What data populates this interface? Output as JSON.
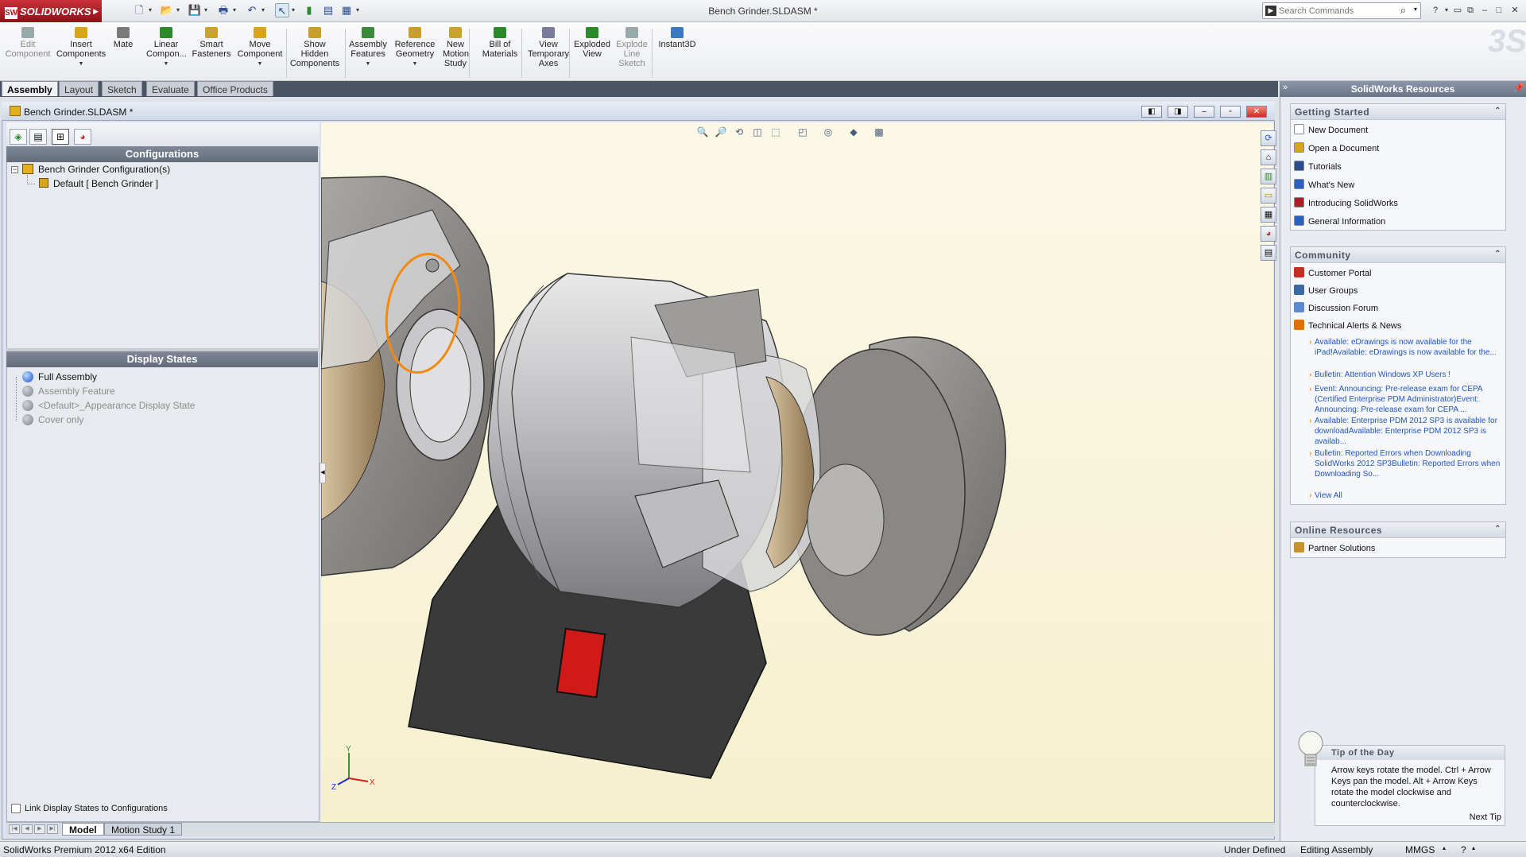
{
  "app": {
    "brand": "SOLIDWORKS",
    "window_title": "Bench Grinder.SLDASM *"
  },
  "search": {
    "placeholder": "Search Commands"
  },
  "command_manager": {
    "tools": [
      {
        "label": "Edit\nComponent",
        "icon": "edit-component-icon",
        "enabled": false
      },
      {
        "label": "Insert\nComponents",
        "icon": "insert-components-icon",
        "enabled": true
      },
      {
        "label": "Mate",
        "icon": "mate-icon",
        "enabled": true
      },
      {
        "label": "Linear\nCompon...",
        "icon": "linear-pattern-icon",
        "enabled": true
      },
      {
        "label": "Smart\nFasteners",
        "icon": "smart-fasteners-icon",
        "enabled": true
      },
      {
        "label": "Move\nComponent",
        "icon": "move-component-icon",
        "enabled": true
      },
      {
        "label": "Show\nHidden\nComponents",
        "icon": "show-hidden-icon",
        "enabled": true
      },
      {
        "label": "Assembly\nFeatures",
        "icon": "assembly-features-icon",
        "enabled": true
      },
      {
        "label": "Reference\nGeometry",
        "icon": "reference-geometry-icon",
        "enabled": true
      },
      {
        "label": "New\nMotion\nStudy",
        "icon": "motion-study-icon",
        "enabled": true
      },
      {
        "label": "Bill of\nMaterials",
        "icon": "bom-icon",
        "enabled": true
      },
      {
        "label": "View\nTemporary\nAxes",
        "icon": "temporary-axes-icon",
        "enabled": true
      },
      {
        "label": "Exploded\nView",
        "icon": "exploded-view-icon",
        "enabled": true
      },
      {
        "label": "Explode\nLine\nSketch",
        "icon": "explode-line-icon",
        "enabled": false
      },
      {
        "label": "Instant3D",
        "icon": "instant3d-icon",
        "enabled": true
      }
    ]
  },
  "tabs": [
    "Assembly",
    "Layout",
    "Sketch",
    "Evaluate",
    "Office Products"
  ],
  "document": {
    "title": "Bench Grinder.SLDASM *"
  },
  "configurations": {
    "header": "Configurations",
    "root": "Bench Grinder Configuration(s)",
    "child": "Default [ Bench Grinder ]"
  },
  "display_states": {
    "header": "Display States",
    "items": [
      {
        "label": "Full Assembly",
        "active": true
      },
      {
        "label": "Assembly Feature",
        "active": false
      },
      {
        "label": "<Default>_Appearance Display State",
        "active": false
      },
      {
        "label": "Cover only",
        "active": false
      }
    ]
  },
  "link_display_states": "Link Display States to Configurations",
  "bottom_tabs": [
    "Model",
    "Motion Study 1"
  ],
  "triad": {
    "x": "X",
    "y": "Y",
    "z": "Z"
  },
  "task_pane": {
    "title": "SolidWorks Resources",
    "getting_started": {
      "header": "Getting Started",
      "items": [
        "New Document",
        "Open a Document",
        "Tutorials",
        "What's New",
        "Introducing SolidWorks",
        "General Information"
      ]
    },
    "community": {
      "header": "Community",
      "items": [
        "Customer Portal",
        "User Groups",
        "Discussion Forum",
        "Technical Alerts & News"
      ],
      "news": [
        "Available: eDrawings is now available for the iPad!Available: eDrawings is now available for the...",
        "Bulletin: Attention Windows XP Users !",
        "Event: Announcing: Pre-release exam for CEPA (Certified Enterprise PDM Administrator)Event: Announcing: Pre-release exam for CEPA ...",
        "Available: Enterprise PDM 2012 SP3 is available for downloadAvailable: Enterprise PDM 2012 SP3 is availab...",
        "Bulletin: Reported Errors when Downloading SolidWorks 2012 SP3Bulletin: Reported Errors when Downloading So..."
      ],
      "view_all": "View All"
    },
    "online_resources": {
      "header": "Online Resources",
      "items": [
        "Partner Solutions"
      ]
    },
    "tip": {
      "header": "Tip of the Day",
      "body": "Arrow keys rotate the model. Ctrl + Arrow Keys pan the model. Alt + Arrow Keys rotate the model clockwise and counterclockwise.",
      "next": "Next Tip"
    }
  },
  "status_bar": {
    "edition": "SolidWorks Premium 2012 x64 Edition",
    "definition": "Under Defined",
    "mode": "Editing Assembly",
    "units": "MMGS"
  }
}
